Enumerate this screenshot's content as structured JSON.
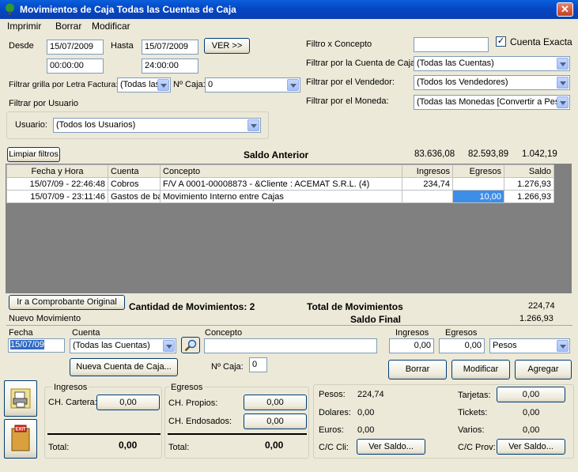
{
  "window": {
    "title": "Movimientos de Caja Todas las Cuentas de Caja",
    "close": "✕"
  },
  "menu": [
    "Imprimir",
    "Borrar",
    "Modificar"
  ],
  "filters": {
    "desde_label": "Desde",
    "desde_date": "15/07/2009",
    "desde_time": "00:00:00",
    "hasta_label": "Hasta",
    "hasta_date": "15/07/2009",
    "hasta_time": "24:00:00",
    "ver_button": "VER >>",
    "letra_label": "Filtrar grilla por Letra Factura:",
    "letra_value": "(Todas las",
    "caja_label": "Nº Caja:",
    "caja_value": "0",
    "usuario_group": "Filtrar por Usuario",
    "usuario_label": "Usuario:",
    "usuario_value": "(Todos los Usuarios)",
    "concepto_label": "Filtro x Concepto",
    "concepto_value": "",
    "cuenta_exacta_label": "Cuenta Exacta",
    "cuenta_exacta_mark": "✓",
    "cuenta_caja_label": "Filtrar por la Cuenta de Caja:",
    "cuenta_caja_value": "(Todas las Cuentas)",
    "vendedor_label": "Filtrar por el Vendedor:",
    "vendedor_value": "(Todos los Vendedores)",
    "moneda_label": "Filtrar por el Moneda:",
    "moneda_value": "(Todas las Monedas [Convertir a Peso"
  },
  "saldo_anterior": {
    "clear_button": "Limpiar filtros",
    "label": "Saldo Anterior",
    "v1": "83.636,08",
    "v2": "82.593,89",
    "v3": "1.042,19"
  },
  "grid": {
    "headers": [
      "Fecha y Hora",
      "Cuenta",
      "Concepto",
      "Ingresos",
      "Egresos",
      "Saldo"
    ],
    "rows": [
      [
        "15/07/09 - 22:46:48",
        "Cobros",
        "F/V A 0001-00008873 - &Cliente : ACEMAT S.R.L. (4)",
        "234,74",
        "",
        "1.276,93"
      ],
      [
        "15/07/09 - 23:11:46",
        "Gastos de ba",
        "Movimiento Interno entre Cajas",
        "",
        "10,00",
        "1.266,93"
      ]
    ]
  },
  "summary": {
    "ir_button": "Ir a Comprobante Original",
    "cantidad_label": "Cantidad de Movimientos: 2",
    "total_label": "Total de Movimientos",
    "total_value": "224,74",
    "nuevo_label": "Nuevo Movimiento",
    "saldo_final_label": "Saldo Final",
    "saldo_final_value": "1.266,93"
  },
  "new_entry": {
    "fecha_label": "Fecha",
    "fecha_value": "15/07/09",
    "cuenta_label": "Cuenta",
    "cuenta_value": "(Todas las Cuentas)",
    "concepto_label": "Concepto",
    "concepto_value": "",
    "ingresos_label": "Ingresos",
    "ingresos_value": "0,00",
    "egresos_label": "Egresos",
    "egresos_value": "0,00",
    "moneda_value": "Pesos",
    "nueva_cuenta_button": "Nueva Cuenta de Caja...",
    "caja_label": "Nº Caja:",
    "caja_value": "0",
    "borrar_button": "Borrar",
    "modificar_button": "Modificar",
    "agregar_button": "Agregar"
  },
  "bottom": {
    "exit_label": "EXIT",
    "ingresos_group": "Ingresos",
    "ch_cartera_label": "CH. Cartera:",
    "ch_cartera_value": "0,00",
    "ingresos_total_label": "Total:",
    "ingresos_total_value": "0,00",
    "egresos_group": "Egresos",
    "ch_propios_label": "CH. Propios:",
    "ch_propios_value": "0,00",
    "ch_endosados_label": "CH. Endosados:",
    "ch_endosados_value": "0,00",
    "egresos_total_label": "Total:",
    "egresos_total_value": "0,00",
    "pesos_label": "Pesos:",
    "pesos_value": "224,74",
    "dolares_label": "Dolares:",
    "dolares_value": "0,00",
    "euros_label": "Euros:",
    "euros_value": "0,00",
    "cc_cli_label": "C/C Cli:",
    "cc_cli_button": "Ver Saldo...",
    "tarjetas_label": "Tarjetas:",
    "tarjetas_value": "0,00",
    "tickets_label": "Tickets:",
    "tickets_value": "0,00",
    "varios_label": "Varios:",
    "varios_value": "0,00",
    "cc_prov_label": "C/C Prov:",
    "cc_prov_button": "Ver Saldo..."
  }
}
